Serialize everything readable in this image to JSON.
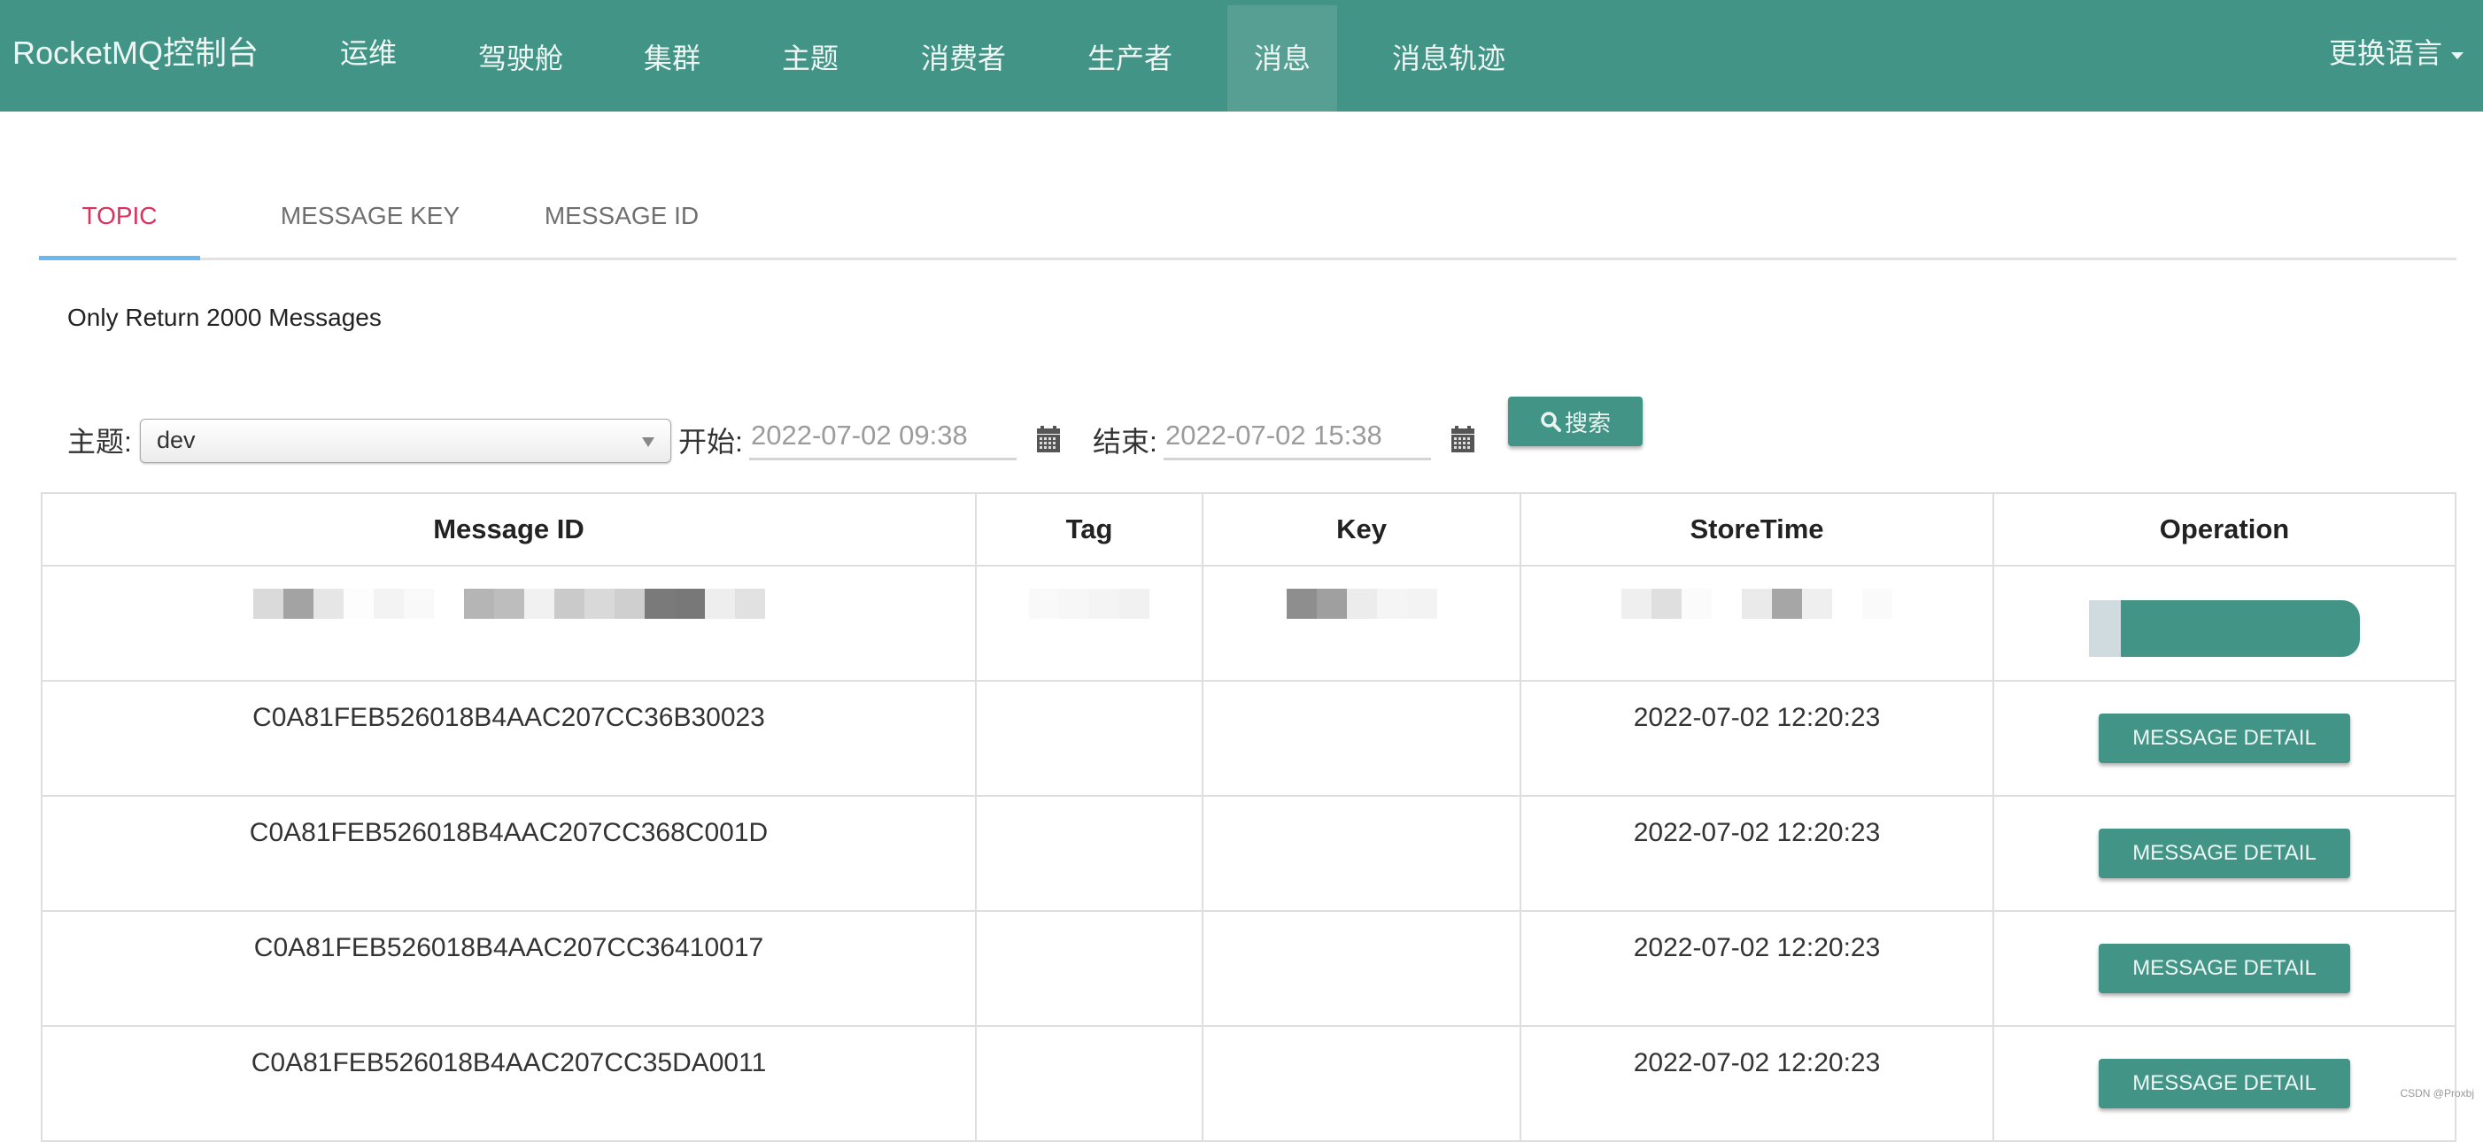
{
  "navbar": {
    "brand": "RocketMQ控制台",
    "items": [
      {
        "label": "运维",
        "active": false
      },
      {
        "label": "驾驶舱",
        "active": false
      },
      {
        "label": "集群",
        "active": false
      },
      {
        "label": "主题",
        "active": false
      },
      {
        "label": "消费者",
        "active": false
      },
      {
        "label": "生产者",
        "active": false
      },
      {
        "label": "消息",
        "active": true
      },
      {
        "label": "消息轨迹",
        "active": false
      }
    ],
    "language": "更换语言"
  },
  "tabs": [
    {
      "label": "TOPIC",
      "active": true
    },
    {
      "label": "MESSAGE KEY",
      "active": false
    },
    {
      "label": "MESSAGE ID",
      "active": false
    }
  ],
  "notice": "Only Return 2000 Messages",
  "filter": {
    "topic_label": "主题:",
    "topic_value": "dev",
    "start_label": "开始:",
    "start_value": "2022-07-02 09:38",
    "end_label": "结束:",
    "end_value": "2022-07-02 15:38",
    "search_label": "搜索"
  },
  "table": {
    "columns": [
      "Message ID",
      "Tag",
      "Key",
      "StoreTime",
      "Operation"
    ],
    "rows": [
      {
        "message_id": "[redacted]",
        "tag": "[redacted]",
        "key": "[redacted]",
        "store_time": "[redacted]",
        "operation": "[redacted]",
        "redacted": true
      },
      {
        "message_id": "C0A81FEB526018B4AAC207CC36B30023",
        "tag": "",
        "key": "",
        "store_time": "2022-07-02 12:20:23",
        "operation": "MESSAGE DETAIL"
      },
      {
        "message_id": "C0A81FEB526018B4AAC207CC368C001D",
        "tag": "",
        "key": "",
        "store_time": "2022-07-02 12:20:23",
        "operation": "MESSAGE DETAIL"
      },
      {
        "message_id": "C0A81FEB526018B4AAC207CC36410017",
        "tag": "",
        "key": "",
        "store_time": "2022-07-02 12:20:23",
        "operation": "MESSAGE DETAIL"
      },
      {
        "message_id": "C0A81FEB526018B4AAC207CC35DA0011",
        "tag": "",
        "key": "",
        "store_time": "2022-07-02 12:20:23",
        "operation": "MESSAGE DETAIL"
      }
    ]
  },
  "watermark": "CSDN @Proxbj",
  "colors": {
    "primary": "#419486",
    "nav_active": "#579f93",
    "tab_active_text": "#d9325f",
    "tab_ink": "#6ab8ee"
  }
}
